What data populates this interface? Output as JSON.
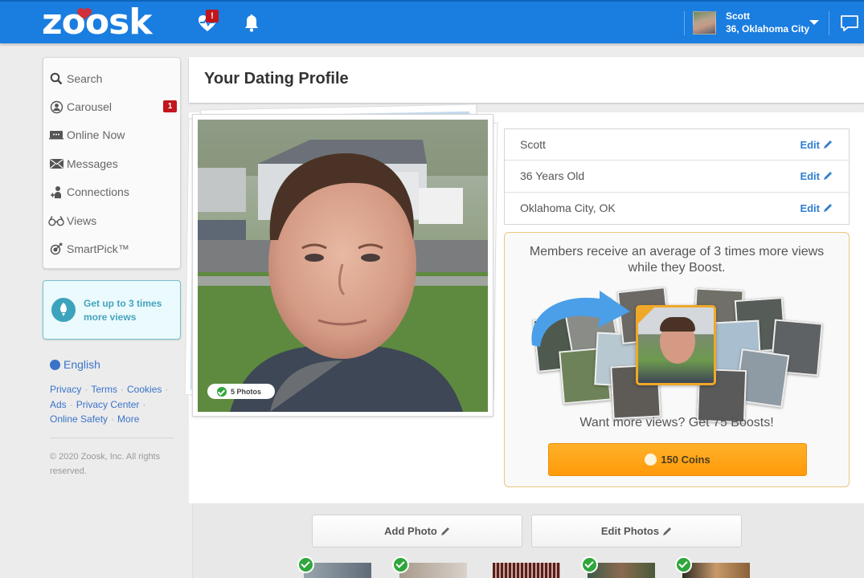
{
  "brand": {
    "logo": "zoosk",
    "primary_color": "#1a7de0",
    "accent_color": "#c0161c"
  },
  "topbar": {
    "heartbeat_badge": "!",
    "user": {
      "name": "Scott",
      "location": "36, Oklahoma City"
    },
    "icons": [
      "heartbeat-icon",
      "bell-icon",
      "chevron-down-icon",
      "chat-icon"
    ]
  },
  "sidebar": {
    "items": [
      {
        "label": "Search",
        "icon": "search-icon"
      },
      {
        "label": "Carousel",
        "icon": "carousel-icon",
        "badge": "1"
      },
      {
        "label": "Online Now",
        "icon": "online-now-icon"
      },
      {
        "label": "Messages",
        "icon": "envelope-icon"
      },
      {
        "label": "Connections",
        "icon": "connections-icon"
      },
      {
        "label": "Views",
        "icon": "glasses-icon"
      },
      {
        "label": "SmartPick™",
        "icon": "smartpick-icon"
      }
    ],
    "promo": {
      "text": "Get up to 3 times more views",
      "icon": "rocket-icon"
    },
    "language": "English",
    "footer_links": [
      "Privacy",
      "Terms",
      "Cookies",
      "Ads",
      "Privacy Center",
      "Online Safety",
      "More"
    ],
    "copyright": "© 2020 Zoosk, Inc. All rights reserved."
  },
  "main": {
    "title": "Your Dating Profile",
    "photo": {
      "count_label": "5 Photos"
    },
    "info_rows": [
      {
        "value": "Scott",
        "edit_label": "Edit"
      },
      {
        "value": "36 Years Old",
        "edit_label": "Edit"
      },
      {
        "value": "Oklahoma City, OK",
        "edit_label": "Edit"
      }
    ],
    "boost": {
      "headline": "Members receive an average of 3 times more views while they Boost.",
      "offer": "Want more views? Get 75 Boosts!",
      "button_label": "150 Coins",
      "button_color": "#ff9a0a"
    },
    "photo_actions": {
      "add_label": "Add Photo",
      "edit_label": "Edit Photos"
    },
    "thumbnails": [
      {
        "approved": true
      },
      {
        "approved": true
      },
      {
        "approved": false
      },
      {
        "approved": true
      },
      {
        "approved": true
      }
    ]
  }
}
